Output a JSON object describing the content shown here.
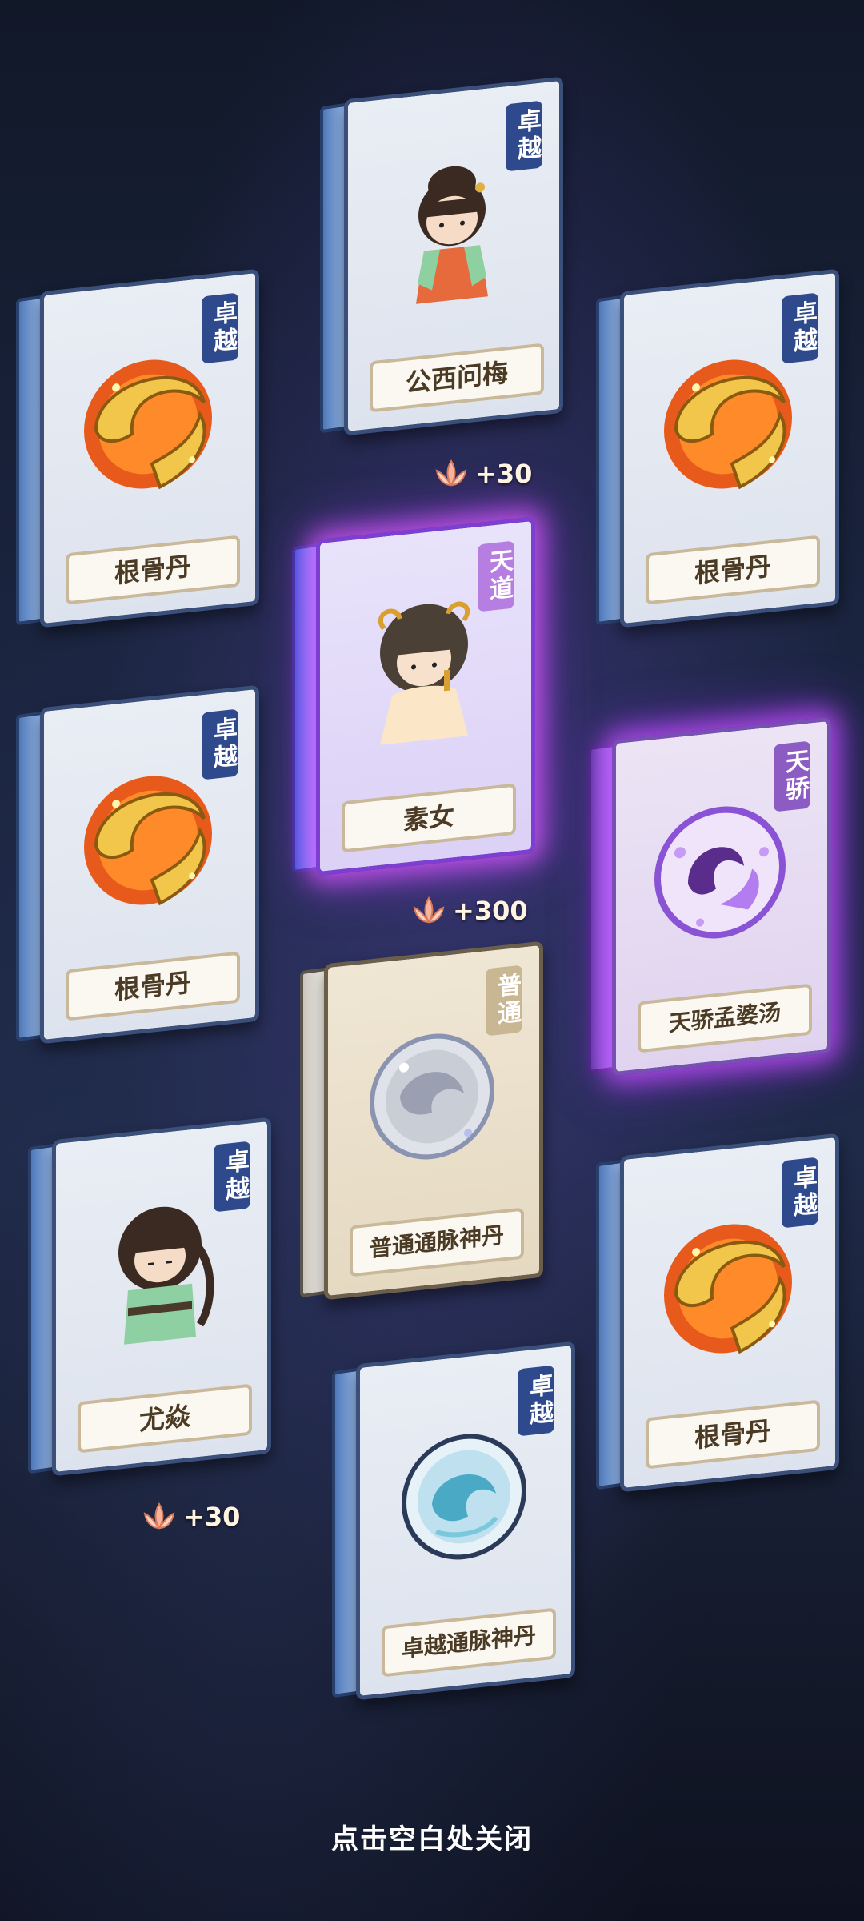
{
  "cards": [
    {
      "id": "c1",
      "rarity": "卓越",
      "name": "公西问梅",
      "art": "chibi-girl-red-dress"
    },
    {
      "id": "c2",
      "rarity": "卓越",
      "name": "根骨丹",
      "art": "golden-orb-pill"
    },
    {
      "id": "c3",
      "rarity": "卓越",
      "name": "根骨丹",
      "art": "golden-orb-pill"
    },
    {
      "id": "c4",
      "rarity": "天道",
      "name": "素女",
      "art": "chibi-goddess"
    },
    {
      "id": "c5",
      "rarity": "卓越",
      "name": "根骨丹",
      "art": "golden-orb-pill"
    },
    {
      "id": "c6",
      "rarity": "天骄",
      "name": "天骄孟婆汤",
      "art": "purple-swirl-orb"
    },
    {
      "id": "c7",
      "rarity": "普通",
      "name": "普通通脉神丹",
      "art": "silver-orb-pill"
    },
    {
      "id": "c8",
      "rarity": "卓越",
      "name": "尤焱",
      "art": "chibi-boy-green-robe"
    },
    {
      "id": "c9",
      "rarity": "卓越",
      "name": "根骨丹",
      "art": "golden-orb-pill"
    },
    {
      "id": "c10",
      "rarity": "卓越",
      "name": "卓越通脉神丹",
      "art": "blue-orb-pill"
    }
  ],
  "rewards": [
    {
      "text": "+30",
      "icon": "lotus-icon"
    },
    {
      "text": "+300",
      "icon": "lotus-icon"
    },
    {
      "text": "+30",
      "icon": "lotus-icon"
    }
  ],
  "footer": {
    "close_hint": "点击空白处关闭"
  }
}
